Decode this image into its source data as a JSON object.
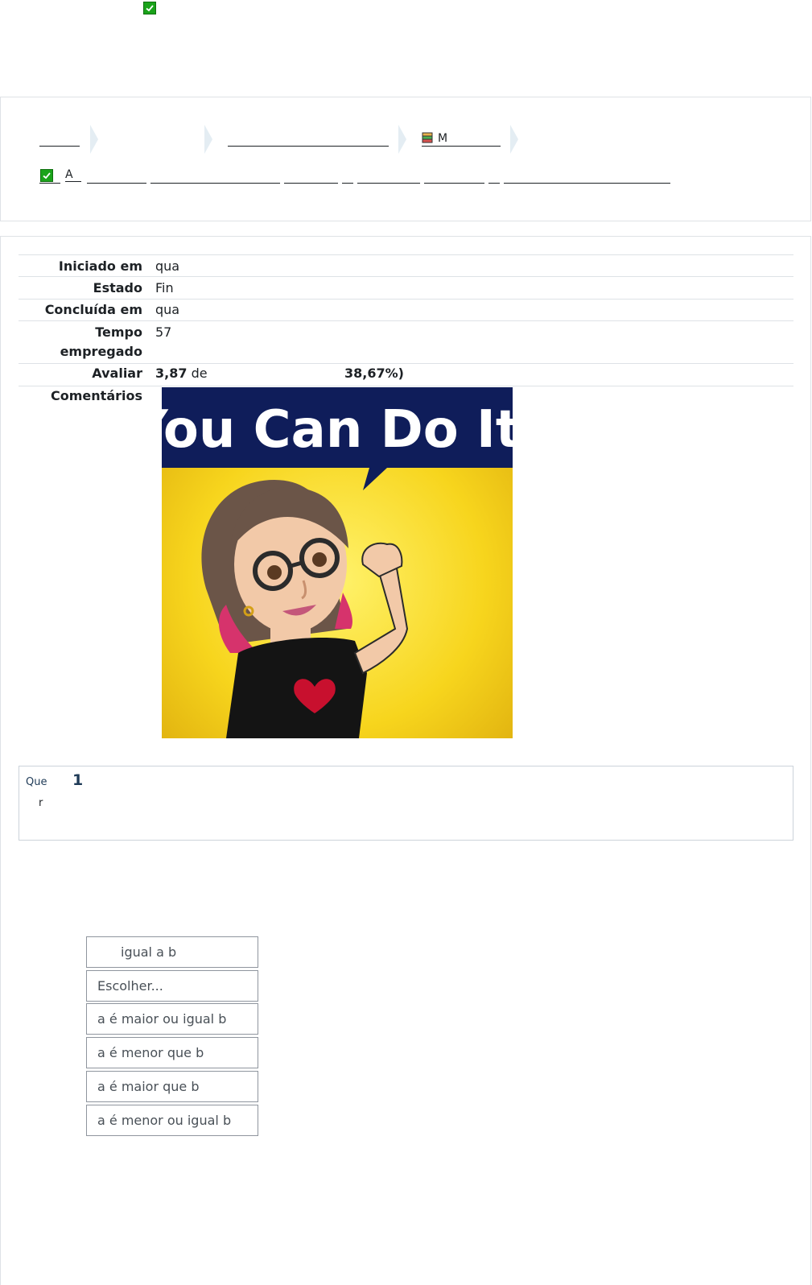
{
  "top": {
    "check_icon": "checkbox-check-icon"
  },
  "breadcrumb": {
    "items": [
      "",
      "",
      "",
      "M"
    ],
    "sub_item_label": "A"
  },
  "summary": {
    "rows": [
      {
        "label": "Iniciado em",
        "value": "qua"
      },
      {
        "label": "Estado",
        "value": "Fin"
      },
      {
        "label": "Concluída em",
        "value": "qua"
      },
      {
        "label": "Tempo empregado",
        "label_line1": "Tempo",
        "label_line2": "empregado",
        "value": "57"
      },
      {
        "label": "Avaliar",
        "value_bold": "3,87",
        "value_mid": "de",
        "value_end": "38,67%)"
      },
      {
        "label": "Comentários",
        "image_caption": "You Can Do It!"
      }
    ]
  },
  "question": {
    "label_prefix": "Que",
    "number": "1",
    "status": "r"
  },
  "options": [
    "igual a b",
    "Escolher...",
    "a é maior ou igual b",
    "a é menor que b",
    "a é maior que b",
    "a é menor ou igual b"
  ],
  "colors": {
    "check_green": "#1aa31a",
    "border": "#dee2e6",
    "banner_navy": "#0f1d5a",
    "background_yellow": "#f7d51d"
  }
}
